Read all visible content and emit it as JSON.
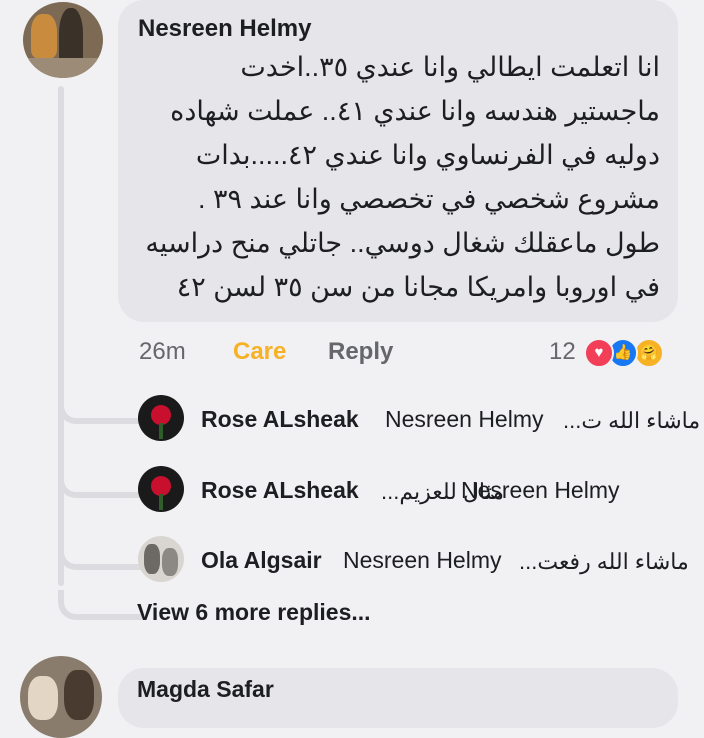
{
  "comment": {
    "author": "Nesreen Helmy",
    "lines": [
      "انا اتعلمت ايطالي وانا عندي ٣٥..اخدت",
      "ماجستير هندسه وانا عندي ٤١.. عملت شهاده",
      "دوليه في الفرنساوي وانا عندي ٤٢.....بدات",
      "مشروع شخصي في تخصصي وانا عند ٣٩ .",
      "طول ماعقلك شغال دوسي.. جاتلي منح دراسيه",
      "في اوروبا وامريكا مجانا من سن ٣٥ لسن ٤٢"
    ],
    "time": "26m",
    "care_label": "Care",
    "reply_label": "Reply",
    "reaction_count": "12",
    "reaction_icons": [
      "love-reaction",
      "like-reaction",
      "care-reaction"
    ],
    "reaction_glyphs": [
      "♥",
      "👍",
      "🤗"
    ]
  },
  "replies": [
    {
      "name": "Rose ALsheak",
      "mention": "Nesreen Helmy",
      "text": "ماشاء الله ت..."
    },
    {
      "name": "Rose ALsheak",
      "mention": "Nesreen Helmy",
      "text": "مثال للعزيم..."
    },
    {
      "name": "Ola Algsair",
      "mention": "Nesreen Helmy",
      "text": "ماشاء الله رفعت..."
    }
  ],
  "view_more": "View 6 more replies...",
  "next_comment": {
    "author": "Magda Safar"
  },
  "colors": {
    "care": "#f7b125",
    "love": "#f33e58",
    "like": "#1877f2",
    "bubble": "#e6e5ea"
  }
}
